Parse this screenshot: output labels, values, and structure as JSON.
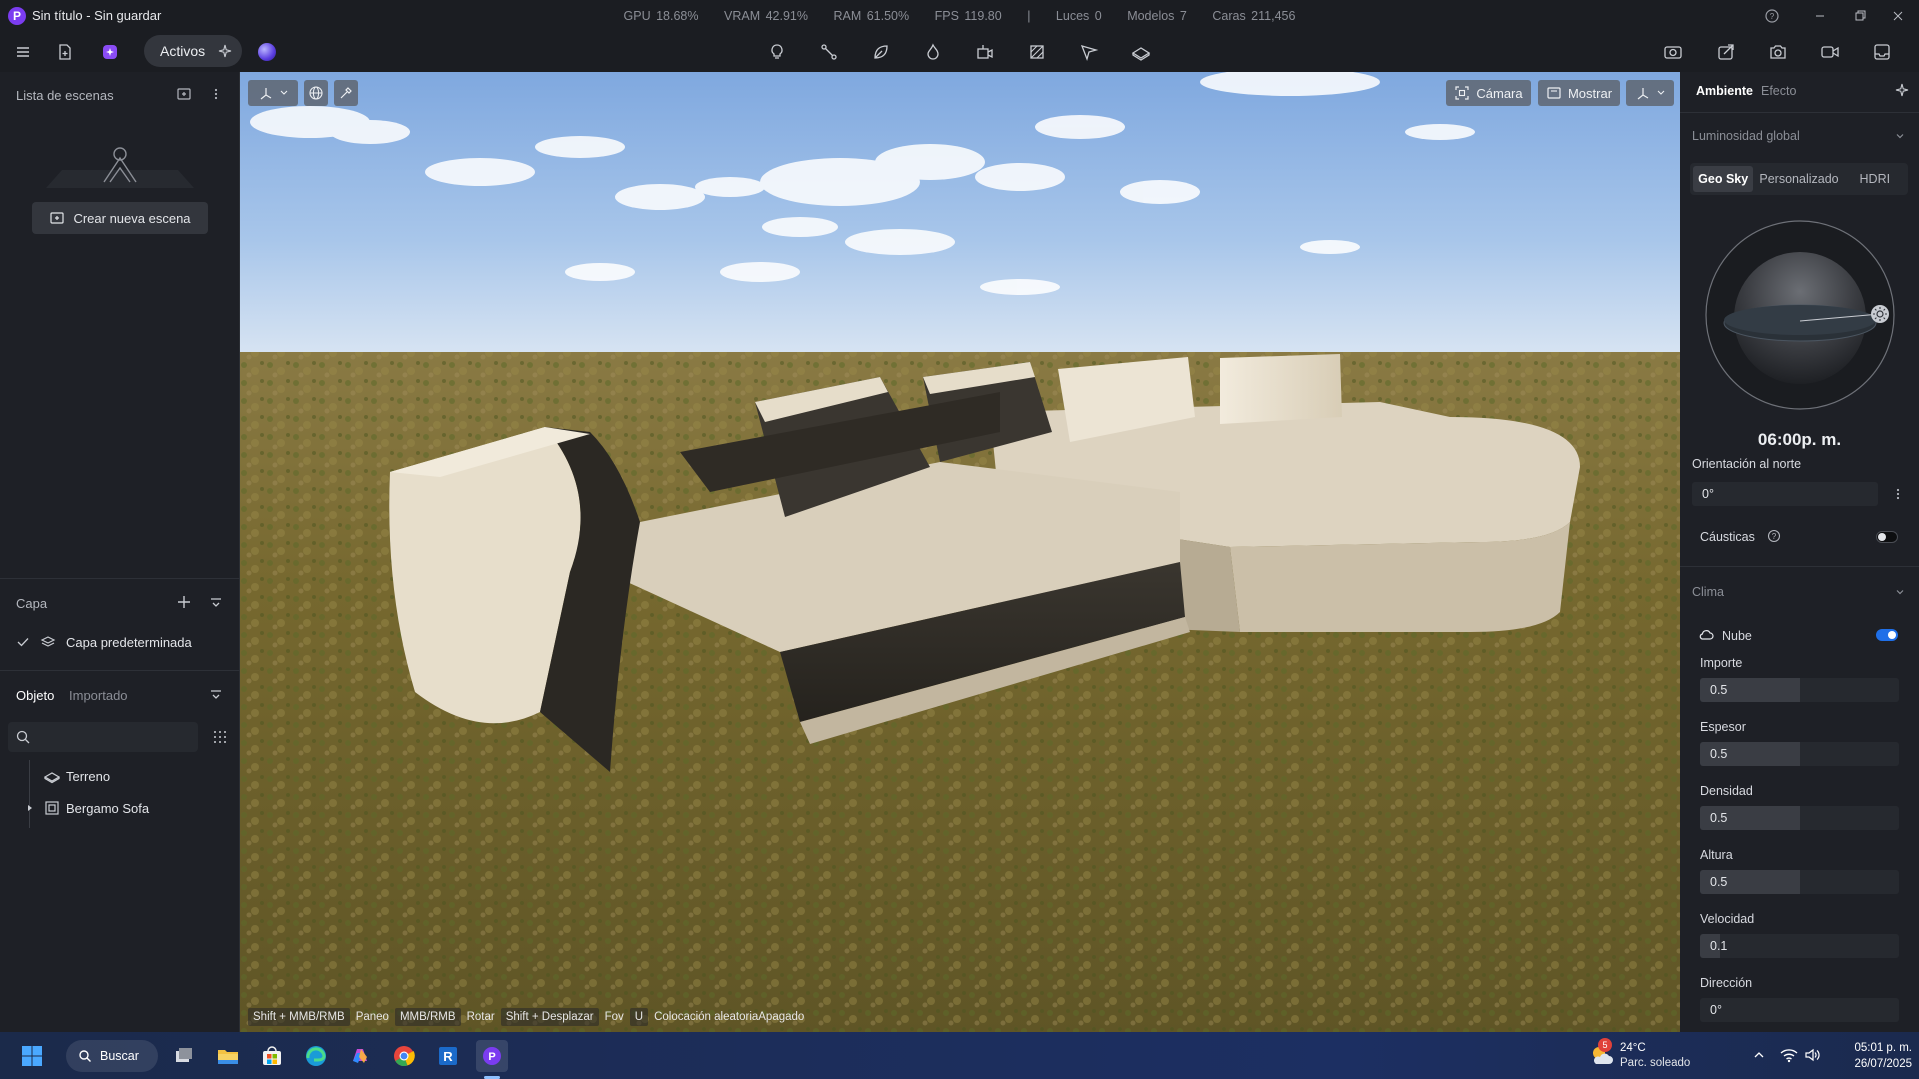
{
  "window": {
    "app_icon_letter": "P",
    "title": "Sin título - Sin guardar",
    "stats": {
      "gpu": "GPU 18.68%",
      "vram": "VRAM 42.91%",
      "ram": "RAM 61.50%",
      "fps": "FPS 119.80",
      "separator": "|",
      "lights": "Luces 0",
      "models": "Modelos 7",
      "faces": "Caras 211,456"
    }
  },
  "toolbar": {
    "assets_label": "Activos",
    "center_tools": [
      "light-bulb-icon",
      "path-tool-icon",
      "leaf-icon",
      "fire-icon",
      "camera-move-icon",
      "section-icon",
      "path-camera-icon",
      "plane-icon"
    ],
    "right_tools": [
      "render-camera-icon",
      "export-icon",
      "screenshot-icon",
      "video-icon",
      "inbox-icon"
    ]
  },
  "left_panel": {
    "scene_list_title": "Lista de escenas",
    "create_scene_label": "Crear nueva escena",
    "layer_title": "Capa",
    "default_layer": "Capa predeterminada",
    "tabs": {
      "object": "Objeto",
      "imported": "Importado"
    },
    "tree": [
      {
        "label": "Terreno",
        "icon": "terrain-icon",
        "expandable": false
      },
      {
        "label": "Bergamo Sofa",
        "icon": "model-icon",
        "expandable": true
      }
    ]
  },
  "viewport": {
    "camera_label": "Cámara",
    "show_label": "Mostrar",
    "hints": [
      {
        "key": "Shift + MMB/RMB",
        "action": "Paneo"
      },
      {
        "key": "MMB/RMB",
        "action": "Rotar"
      },
      {
        "key": "Shift + Desplazar",
        "action": "Fov"
      },
      {
        "key": "U",
        "action": "Colocación aleatoriaApagado"
      }
    ]
  },
  "right_panel": {
    "tabs": {
      "ambient": "Ambiente",
      "effect": "Efecto"
    },
    "global_light_title": "Luminosidad global",
    "sky_tabs": [
      "Geo Sky",
      "Personalizado",
      "HDRI"
    ],
    "sky_selected": "Geo Sky",
    "time": "06:00p. m.",
    "north_label": "Orientación al norte",
    "north_value": "0°",
    "caustics_label": "Cáusticas",
    "caustics_on": false,
    "weather_title": "Clima",
    "cloud_label": "Nube",
    "cloud_on": true,
    "sliders": [
      {
        "label": "Importe",
        "value": "0.5",
        "fraction": 0.5
      },
      {
        "label": "Espesor",
        "value": "0.5",
        "fraction": 0.5
      },
      {
        "label": "Densidad",
        "value": "0.5",
        "fraction": 0.5
      },
      {
        "label": "Altura",
        "value": "0.5",
        "fraction": 0.5
      },
      {
        "label": "Velocidad",
        "value": "0.1",
        "fraction": 0.1
      },
      {
        "label": "Dirección",
        "value": "0°",
        "fraction": 0
      }
    ],
    "accent_color": "#1f6fe8"
  },
  "taskbar": {
    "search_label": "Buscar",
    "weather_temp": "24°C",
    "weather_desc": "Parc. soleado",
    "weather_badge": "5",
    "time": "05:01 p. m.",
    "date": "26/07/2025"
  }
}
